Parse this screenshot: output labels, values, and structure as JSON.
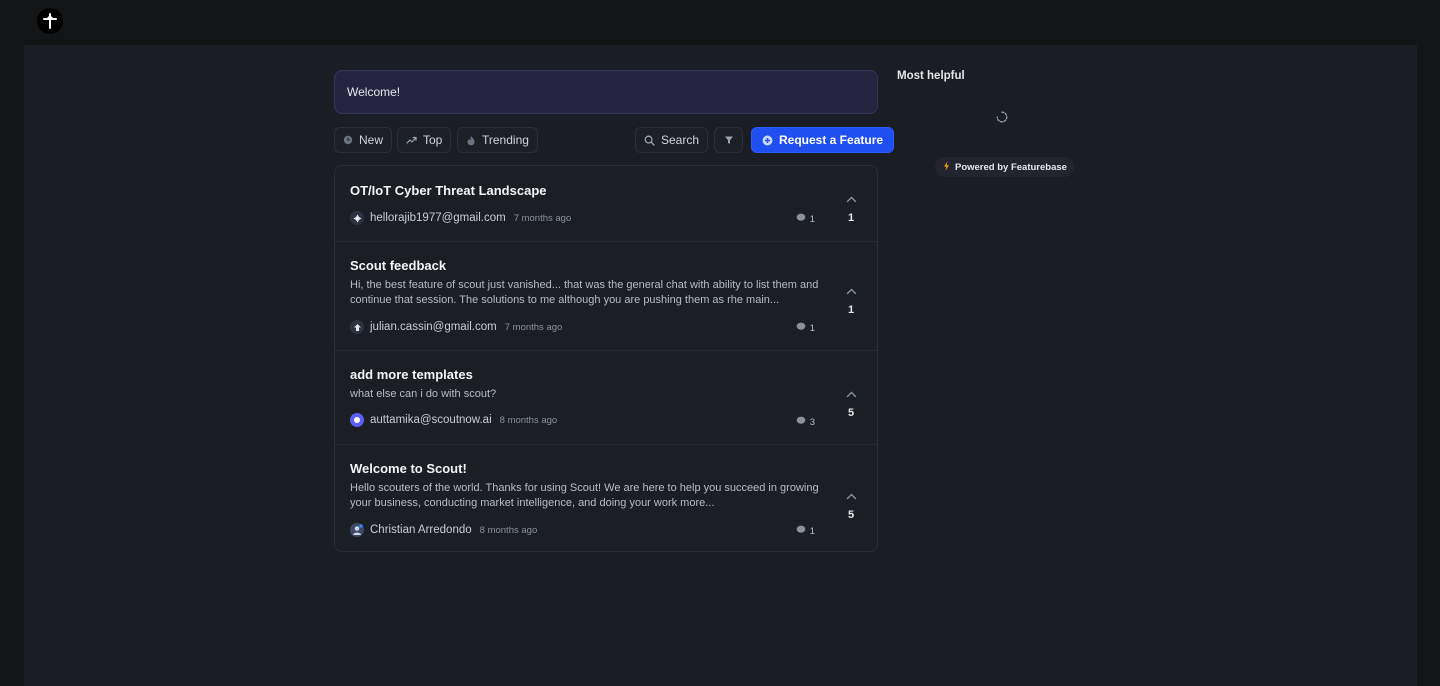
{
  "app": {
    "logo_icon": "scout-logo-icon"
  },
  "welcome": {
    "text": "Welcome!"
  },
  "sort_tabs": [
    {
      "label": "New",
      "icon": "clock-icon"
    },
    {
      "label": "Top",
      "icon": "trend-up-icon"
    },
    {
      "label": "Trending",
      "icon": "flame-icon"
    }
  ],
  "toolbar": {
    "search_label": "Search",
    "filter_icon": "filter-icon",
    "request_label": "Request a Feature"
  },
  "posts": [
    {
      "title": "OT/IoT Cyber Threat Landscape",
      "description": "",
      "author": "hellorajib1977@gmail.com",
      "time": "7 months ago",
      "comments": "1",
      "votes": "1"
    },
    {
      "title": "Scout feedback",
      "description": "Hi, the best feature of scout just vanished... that was the general chat with ability to list them and continue that session. The solutions to me although you are pushing them as rhe main...",
      "author": "julian.cassin@gmail.com",
      "time": "7 months ago",
      "comments": "1",
      "votes": "1"
    },
    {
      "title": "add more templates",
      "description": "what else can i do with scout?",
      "author": "auttamika@scoutnow.ai",
      "time": "8 months ago",
      "comments": "3",
      "votes": "5"
    },
    {
      "title": "Welcome to Scout!",
      "description": "Hello scouters of the world. Thanks for using Scout! We are here to help you succeed in growing your business, conducting market intelligence, and doing your work more...",
      "author": "Christian Arredondo",
      "time": "8 months ago",
      "comments": "1",
      "votes": "5"
    }
  ],
  "sidebar": {
    "title": "Most helpful",
    "powered_by": "Powered by Featurebase"
  },
  "colors": {
    "background": "#131416",
    "panel": "#1b1d24",
    "accent": "#1f4ff0",
    "welcome_bg": "#252541"
  }
}
